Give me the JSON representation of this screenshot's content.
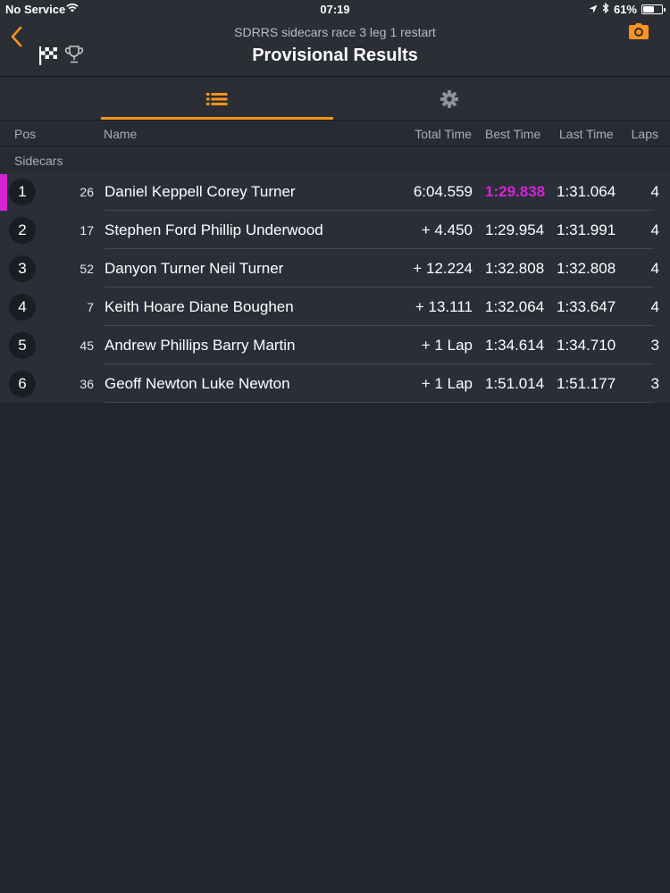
{
  "status_bar": {
    "carrier": "No Service",
    "time": "07:19",
    "battery": "61%",
    "battery_level": 0.61
  },
  "header": {
    "subtitle": "SDRRS sidecars race 3 leg 1 restart",
    "title": "Provisional Results",
    "accent_color": "#f7931e"
  },
  "tabs": [
    {
      "name": "list",
      "icon": "list-icon",
      "selected": true
    },
    {
      "name": "settings",
      "icon": "gear-icon",
      "selected": false
    }
  ],
  "columns": {
    "pos": "Pos",
    "name": "Name",
    "total": "Total Time",
    "best": "Best Time",
    "last": "Last Time",
    "laps": "Laps"
  },
  "group": "Sidecars",
  "fastest_color": "#d524d5",
  "results": [
    {
      "pos": "1",
      "num": "26",
      "name": "Daniel Keppell Corey Turner",
      "total": "6:04.559",
      "best": "1:29.838",
      "last": "1:31.064",
      "laps": "4",
      "fastest": true
    },
    {
      "pos": "2",
      "num": "17",
      "name": "Stephen Ford Phillip Underwood",
      "total": "+ 4.450",
      "best": "1:29.954",
      "last": "1:31.991",
      "laps": "4",
      "fastest": false
    },
    {
      "pos": "3",
      "num": "52",
      "name": "Danyon Turner Neil Turner",
      "total": "+ 12.224",
      "best": "1:32.808",
      "last": "1:32.808",
      "laps": "4",
      "fastest": false
    },
    {
      "pos": "4",
      "num": "7",
      "name": "Keith Hoare Diane Boughen",
      "total": "+ 13.111",
      "best": "1:32.064",
      "last": "1:33.647",
      "laps": "4",
      "fastest": false
    },
    {
      "pos": "5",
      "num": "45",
      "name": "Andrew Phillips Barry Martin",
      "total": "+ 1 Lap",
      "best": "1:34.614",
      "last": "1:34.710",
      "laps": "3",
      "fastest": false
    },
    {
      "pos": "6",
      "num": "36",
      "name": "Geoff Newton Luke Newton",
      "total": "+ 1 Lap",
      "best": "1:51.014",
      "last": "1:51.177",
      "laps": "3",
      "fastest": false
    }
  ]
}
